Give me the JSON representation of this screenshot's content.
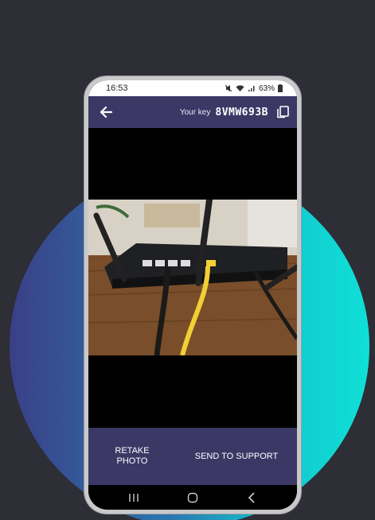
{
  "status_bar": {
    "time": "16:53",
    "battery": "63%"
  },
  "app_bar": {
    "back_icon": "arrow-left-icon",
    "key_label": "Your key",
    "key_value": "8VMW693B",
    "copy_icon": "copy-icon"
  },
  "actions": {
    "retake_label": "RETAKE\nPHOTO",
    "send_label": "SEND TO SUPPORT"
  },
  "nav_bar": {
    "recents_icon": "recents-icon",
    "home_icon": "home-icon",
    "back_icon": "nav-back-icon"
  },
  "colors": {
    "app_bar": "#3b3866",
    "background": "#2d2e36",
    "accent_cyan": "#0fe0d6"
  }
}
